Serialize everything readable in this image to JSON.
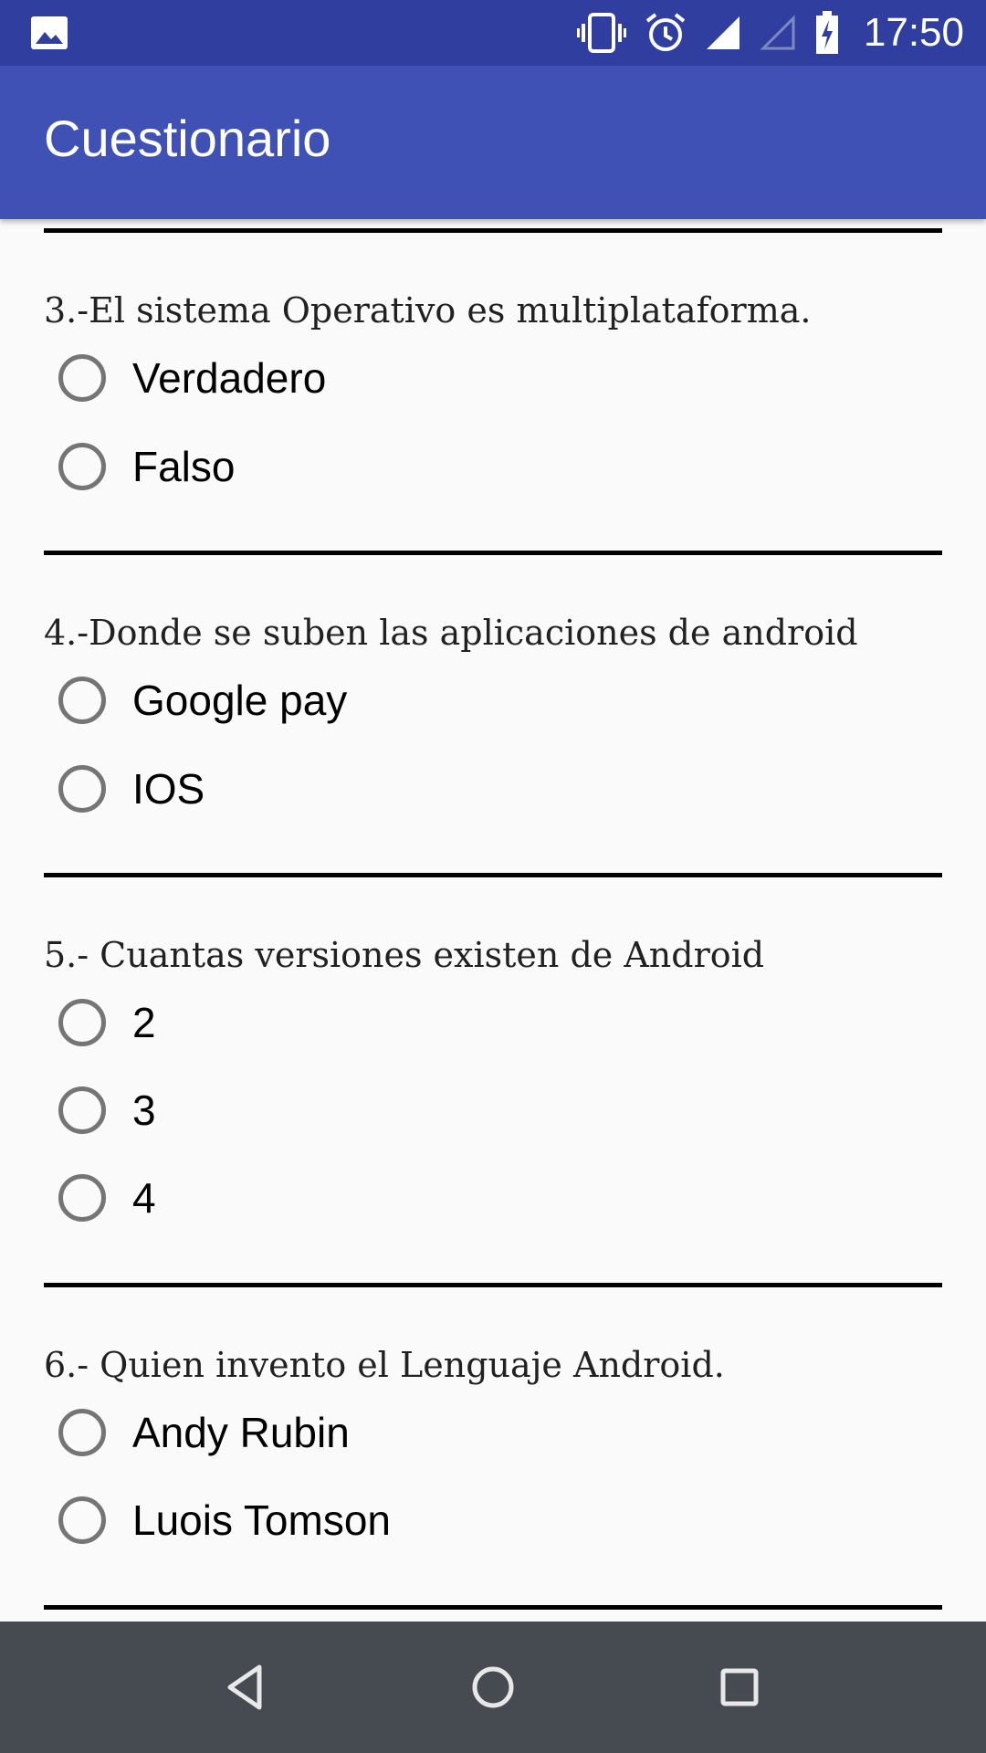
{
  "status_bar": {
    "time": "17:50",
    "icons": [
      "gallery-icon",
      "vibrate-icon",
      "alarm-icon",
      "signal-icon",
      "signal-empty-icon",
      "battery-charging-icon"
    ]
  },
  "app_bar": {
    "title": "Cuestionario"
  },
  "colors": {
    "status_bar": "#303f9f",
    "primary": "#3f51b5",
    "background": "#fafafa",
    "radio_outline": "#757575",
    "nav_bar": "#454b50"
  },
  "questions": [
    {
      "text": "3.-El sistema Operativo es multiplataforma.",
      "options": [
        "Verdadero",
        "Falso"
      ]
    },
    {
      "text": "4.-Donde se suben las aplicaciones de android",
      "options": [
        "Google pay",
        "IOS"
      ]
    },
    {
      "text": "5.- Cuantas versiones existen de Android",
      "options": [
        "2",
        "3",
        "4"
      ]
    },
    {
      "text": "6.- Quien invento el Lenguaje Android.",
      "options": [
        "Andy Rubin",
        "Luois Tomson"
      ]
    }
  ],
  "nav_bar": {
    "buttons": [
      "back-icon",
      "home-icon",
      "recents-icon"
    ]
  }
}
